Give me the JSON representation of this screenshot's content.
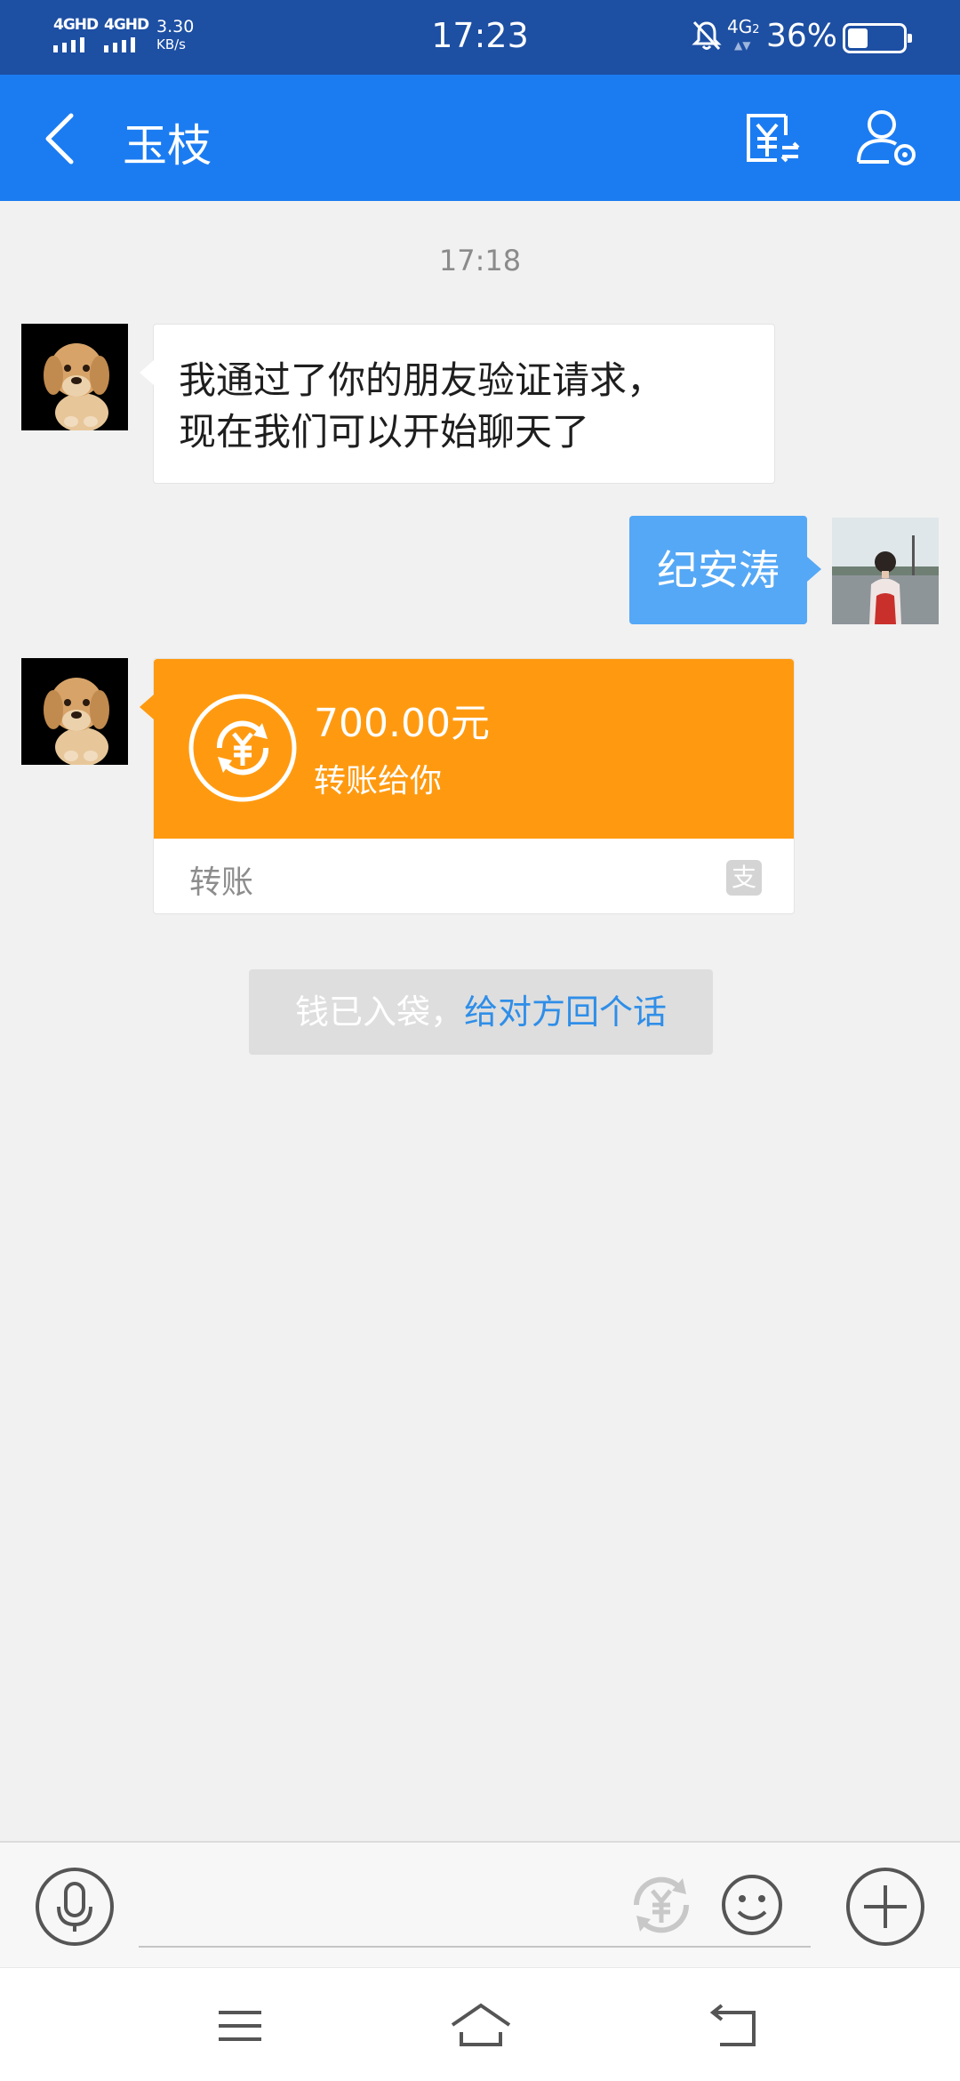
{
  "status_bar": {
    "network_1": "4GHD",
    "network_2": "4GHD",
    "speed_value": "3.30",
    "speed_unit": "KB/s",
    "time": "17:23",
    "network_type": "4G",
    "network_sub": "2",
    "battery_percent": "36%",
    "battery_level": 0.36
  },
  "header": {
    "title": "玉枝",
    "back_icon": "chevron-left-icon",
    "transfer_icon": "yuan-transfer-icon",
    "settings_icon": "user-settings-icon"
  },
  "chat": {
    "timestamp": "17:18",
    "messages": [
      {
        "sender": "contact",
        "text_line_1": "我通过了你的朋友验证请求，",
        "text_line_2": "现在我们可以开始聊天了"
      },
      {
        "sender": "me",
        "text": "纪安涛"
      }
    ],
    "transfer": {
      "amount": "700.00元",
      "description": "转账给你",
      "type_label": "转账",
      "brand_icon": "支"
    },
    "system_note": {
      "prefix": "钱已入袋，",
      "link": "给对方回个话"
    }
  },
  "input_bar": {
    "voice_icon": "microphone-icon",
    "red_packet_icon": "yuan-icon",
    "emoji_icon": "smile-icon",
    "more_icon": "plus-icon"
  },
  "nav_bar": {
    "menu_icon": "menu-icon",
    "home_icon": "home-icon",
    "back_icon": "back-icon"
  },
  "colors": {
    "status_bar": "#1d4fa3",
    "header": "#1b7cf2",
    "outgoing_bubble": "#55a8f5",
    "transfer_card": "#ff9a10",
    "link": "#2f8ee8"
  }
}
